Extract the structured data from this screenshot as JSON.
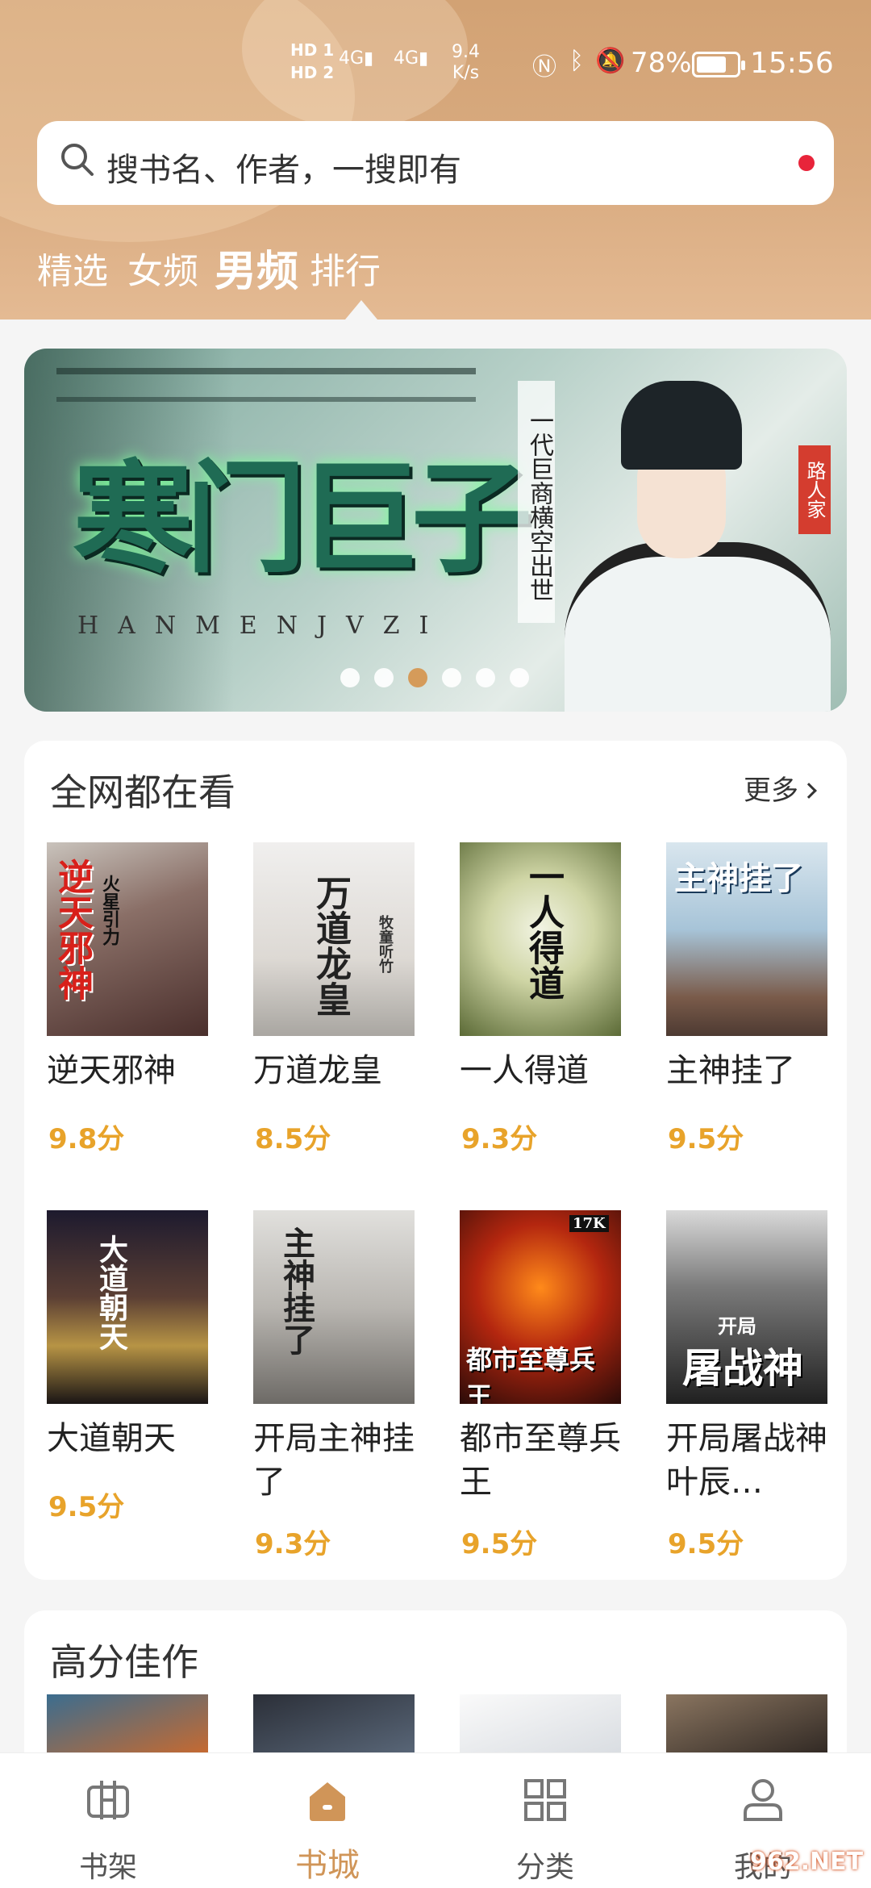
{
  "status_bar": {
    "hd1": "HD 1",
    "hd2": "HD 2",
    "signal1": "4G",
    "signal2": "4G",
    "speed_value": "9.4",
    "speed_unit": "K/s",
    "battery": "78%",
    "time": "15:56"
  },
  "search": {
    "placeholder": "搜书名、作者，一搜即有"
  },
  "tabs": [
    {
      "label": "精选",
      "active": false
    },
    {
      "label": "女频",
      "active": false
    },
    {
      "label": "男频",
      "active": true
    },
    {
      "label": "排行",
      "active": false
    }
  ],
  "banner": {
    "title": "寒门巨子",
    "subtitle": "HANMENJVZI",
    "tagline": "一代巨商横空出世",
    "seal": "路人家",
    "dots": 6,
    "active_dot": 2
  },
  "section_hot": {
    "title": "全网都在看",
    "more": "更多",
    "books": [
      {
        "name": "逆天邪神",
        "score": "9.8分",
        "cover_text": "逆天邪神",
        "cover_side": "火星引力"
      },
      {
        "name": "万道龙皇",
        "score": "8.5分",
        "cover_text": "万道龙皇",
        "cover_side": "牧童听竹"
      },
      {
        "name": "一人得道",
        "score": "9.3分",
        "cover_text": "一人得道",
        "cover_side": ""
      },
      {
        "name": "主神挂了",
        "score": "9.5分",
        "cover_text": "主神挂了",
        "cover_side": ""
      },
      {
        "name": "大道朝天",
        "score": "9.5分",
        "cover_text": "大道朝天",
        "cover_side": ""
      },
      {
        "name": "开局主神挂了",
        "score": "9.3分",
        "cover_text": "主神挂了",
        "cover_side": ""
      },
      {
        "name": "都市至尊兵王",
        "score": "9.5分",
        "cover_text": "都市至尊兵王",
        "cover_side": "17K"
      },
      {
        "name": "开局屠战神叶辰…",
        "score": "9.5分",
        "cover_text": "屠战神",
        "cover_side": "开局"
      }
    ]
  },
  "section_top": {
    "title": "高分佳作"
  },
  "bottom_nav": [
    {
      "label": "书架",
      "icon": "bookshelf-icon",
      "active": false
    },
    {
      "label": "书城",
      "icon": "home-icon",
      "active": true
    },
    {
      "label": "分类",
      "icon": "grid-icon",
      "active": false
    },
    {
      "label": "我的",
      "icon": "user-icon",
      "active": false
    }
  ],
  "watermark": "962.NET",
  "colors": {
    "accent": "#d09558",
    "header": "#d4a478",
    "score": "#e8a32a",
    "badge": "#e8243a"
  }
}
